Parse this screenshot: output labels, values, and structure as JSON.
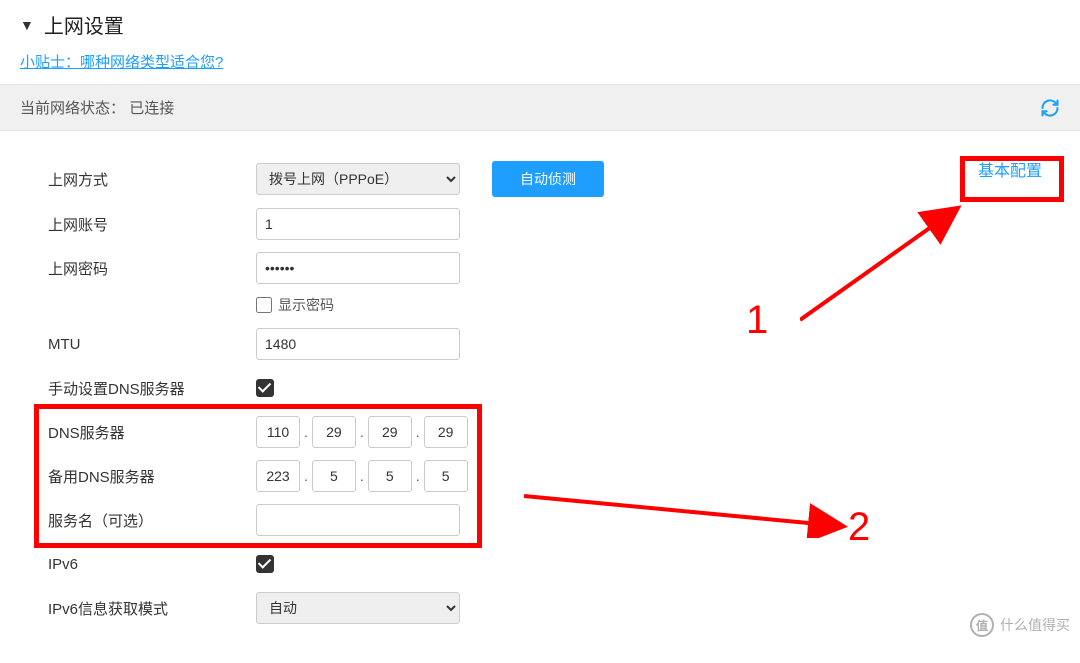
{
  "header": {
    "title": "上网设置"
  },
  "tip": {
    "link": "小贴士：哪种网络类型适合您?"
  },
  "status": {
    "label": "当前网络状态：",
    "value": "已连接"
  },
  "basic_link": "基本配置",
  "form": {
    "method": {
      "label": "上网方式",
      "value": "拨号上网（PPPoE）"
    },
    "auto_detect": "自动侦测",
    "account": {
      "label": "上网账号",
      "value": "1"
    },
    "password": {
      "label": "上网密码",
      "value": "••••••"
    },
    "show_pw": "显示密码",
    "mtu": {
      "label": "MTU",
      "value": "1480"
    },
    "manual_dns": {
      "label": "手动设置DNS服务器"
    },
    "dns": {
      "label": "DNS服务器",
      "octets": [
        "110",
        "29",
        "29",
        "29"
      ]
    },
    "alt_dns": {
      "label": "备用DNS服务器",
      "octets": [
        "223",
        "5",
        "5",
        "5"
      ]
    },
    "service": {
      "label": "服务名（可选）",
      "value": ""
    },
    "ipv6": {
      "label": "IPv6"
    },
    "ipv6_mode": {
      "label": "IPv6信息获取模式",
      "value": "自动"
    }
  },
  "annotations": {
    "num1": "1",
    "num2": "2"
  },
  "watermark": {
    "badge": "值",
    "text": "什么值得买"
  }
}
